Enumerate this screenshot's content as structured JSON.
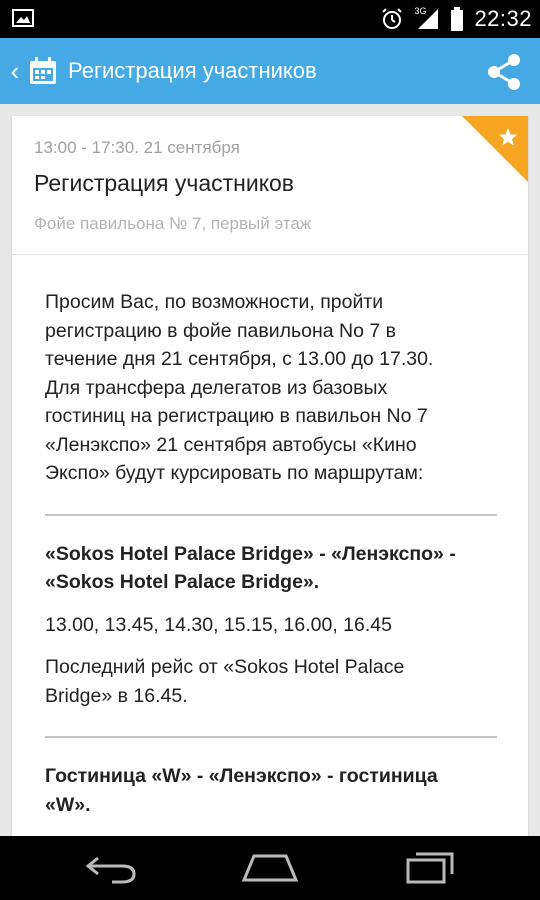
{
  "status_bar": {
    "time": "22:32",
    "network": "3G",
    "icons": [
      "picture-icon",
      "alarm-icon",
      "signal-icon",
      "battery-icon"
    ]
  },
  "action_bar": {
    "title": "Регистрация участников",
    "back_icon": "chevron-left-icon",
    "app_icon": "calendar-icon",
    "share_icon": "share-icon",
    "color": "#45a9e3"
  },
  "event": {
    "time_range": "13:00 - 17:30. 21 сентября",
    "title": "Регистрация участников",
    "location": "Фойе павильона № 7, первый этаж",
    "favorite_icon": "star-icon",
    "ribbon_color": "#f6a623"
  },
  "content": {
    "intro_lines": [
      "Просим Вас, по возможности, пройти",
      "регистрацию в фойе павильона No 7 в",
      "течение дня 21 сентября, с 13.00 до 17.30.",
      "Для трансфера делегатов из базовых",
      "гостиниц на регистрацию в павильон No 7",
      "«Ленэкспо» 21 сентября автобусы «Кино",
      "Экспо» будут курсировать по маршрутам:"
    ],
    "route1_lines": [
      "«Sokos Hotel Palace Bridge» - «Ленэкспо» -",
      "«Sokos Hotel Palace Bridge»."
    ],
    "route1_times": "13.00, 13.45, 14.30, 15.15, 16.00, 16.45",
    "route1_last_lines": [
      "Последний рейс от «Sokos Hotel Palace",
      "Bridge» в 16.45."
    ],
    "route2_lines": [
      "Гостиница «W» - «Ленэкспо» - гостиница",
      "«W»."
    ]
  },
  "nav_bar": {
    "icons": [
      "back-nav-icon",
      "home-nav-icon",
      "recent-apps-icon"
    ]
  }
}
